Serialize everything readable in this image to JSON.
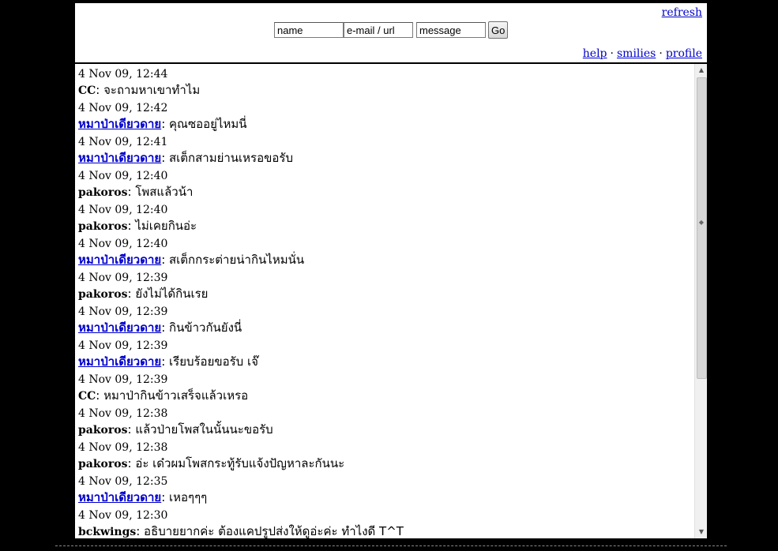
{
  "header": {
    "refresh_label": "refresh",
    "form": {
      "name_value": "name",
      "email_value": "e-mail / url",
      "message_value": "message",
      "go_label": "Go"
    },
    "links": {
      "help": "help",
      "sep1": "·",
      "smilies": "smilies",
      "sep2": "·",
      "profile": "profile"
    }
  },
  "messages": [
    {
      "time": "4 Nov 09, 12:44",
      "name": "CC",
      "linked": false,
      "text": ": จะถามหาเขาทำไม"
    },
    {
      "time": "4 Nov 09, 12:42",
      "name": "หมาป่าเดียวดาย",
      "linked": true,
      "text": ": คุณซออยู่ไหมนี่"
    },
    {
      "time": "4 Nov 09, 12:41",
      "name": "หมาป่าเดียวดาย",
      "linked": true,
      "text": ": สเต็กสามย่านเหรอขอรับ"
    },
    {
      "time": "4 Nov 09, 12:40",
      "name": "pakoros",
      "linked": false,
      "text": ": โพสแล้วน้า"
    },
    {
      "time": "4 Nov 09, 12:40",
      "name": "pakoros",
      "linked": false,
      "text": ": ไม่เคยกินอ่ะ"
    },
    {
      "time": "4 Nov 09, 12:40",
      "name": "หมาป่าเดียวดาย",
      "linked": true,
      "text": ": สเต็กกระต่ายน่ากินไหมนั่น"
    },
    {
      "time": "4 Nov 09, 12:39",
      "name": "pakoros",
      "linked": false,
      "text": ": ยังไม่ได้กินเรย"
    },
    {
      "time": "4 Nov 09, 12:39",
      "name": "หมาป่าเดียวดาย",
      "linked": true,
      "text": ": กินข้าวกันยังนี่"
    },
    {
      "time": "4 Nov 09, 12:39",
      "name": "หมาป่าเดียวดาย",
      "linked": true,
      "text": ": เรียบร้อยขอรับ เจ๊"
    },
    {
      "time": "4 Nov 09, 12:39",
      "name": "CC",
      "linked": false,
      "text": ": หมาป่ากินข้าวเสร็จแล้วเหรอ"
    },
    {
      "time": "4 Nov 09, 12:38",
      "name": "pakoros",
      "linked": false,
      "text": ": แล้วป่ายโพสในนั้นนะขอรับ"
    },
    {
      "time": "4 Nov 09, 12:38",
      "name": "pakoros",
      "linked": false,
      "text": ": อ่ะ เด๋วผมโพสกระทู้รับแจ้งปัญหาละกันนะ"
    },
    {
      "time": "4 Nov 09, 12:35",
      "name": "หมาป่าเดียวดาย",
      "linked": true,
      "text": ": เหอๆๆๆ"
    },
    {
      "time": "4 Nov 09, 12:30",
      "name": "bckwings",
      "linked": false,
      "text": ": อธิบายยากค่ะ ต้องแคปรูปส่งให้ดูอ่ะค่ะ ทำไงดี T^T"
    }
  ]
}
